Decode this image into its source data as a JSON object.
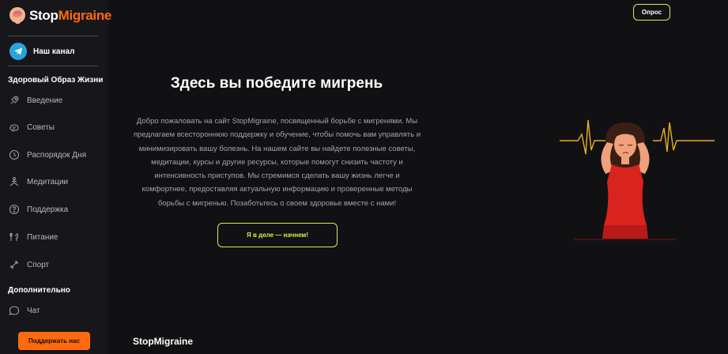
{
  "brand": {
    "name_part1": "Stop",
    "name_part2": "Migraine",
    "accent": "#ff6a10"
  },
  "sidebar": {
    "channel_label": "Наш канал",
    "section1_title": "Здоровый Образ Жизни",
    "items": [
      {
        "label": "Введение",
        "icon": "rocket-icon"
      },
      {
        "label": "Советы",
        "icon": "advice-icon"
      },
      {
        "label": "Распорядок Дня",
        "icon": "clock-icon"
      },
      {
        "label": "Медитации",
        "icon": "meditation-icon"
      },
      {
        "label": "Поддержка",
        "icon": "question-icon"
      },
      {
        "label": "Питание",
        "icon": "food-icon"
      },
      {
        "label": "Спорт",
        "icon": "dumbbell-icon"
      }
    ],
    "section2_title": "Дополнительно",
    "extra_items": [
      {
        "label": "Чат",
        "icon": "chat-icon"
      }
    ],
    "support_button": "Поддержать нас"
  },
  "header": {
    "survey_button": "Опрос",
    "accent": "#d6ec58"
  },
  "hero": {
    "title": "Здесь вы победите мигрень",
    "text": "Добро пожаловать на сайт StopMigraine, посвященный борьбе с мигренями. Мы предлагаем всестороннюю поддержку и обучение, чтобы помочь вам управлять и минимизировать вашу болезнь. На нашем сайте вы найдете полезные советы, медитации, курсы и другие ресурсы, которые помогут снизить частоту и интенсивность приступов. Мы стремимся сделать вашу жизнь легче и комфортнее, предоставляя актуальную информацию и проверенные методы борьбы с мигренью. Позаботьтесь о своем здоровье вместе с нами!",
    "cta_button": "Я в деле — начнем!"
  },
  "footer": {
    "logo_text": "StopMigraine"
  }
}
